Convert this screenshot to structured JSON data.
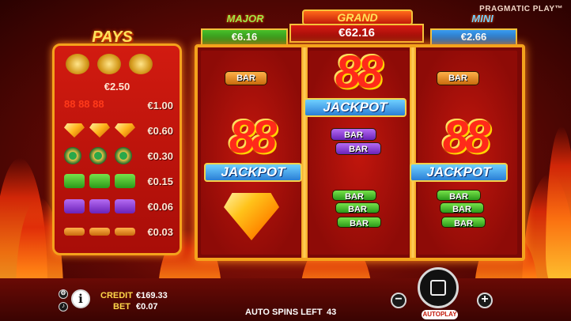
{
  "brand": "PRAGMATIC PLAY™",
  "jackpots": {
    "major": {
      "label": "MAJOR",
      "value": "€6.16"
    },
    "grand": {
      "label": "GRAND",
      "value": "€62.16"
    },
    "mini": {
      "label": "MINI",
      "value": "€2.66"
    }
  },
  "paytable": {
    "title": "PAYS",
    "top_prize": "€2.50",
    "rows": [
      {
        "symbol": "triple-88",
        "value": "€1.00"
      },
      {
        "symbol": "diamond",
        "value": "€0.60"
      },
      {
        "symbol": "coin",
        "value": "€0.30"
      },
      {
        "symbol": "green-bar",
        "value": "€0.15"
      },
      {
        "symbol": "purple-bar",
        "value": "€0.06"
      },
      {
        "symbol": "orange-bar",
        "value": "€0.03"
      }
    ]
  },
  "reels": {
    "bar_text": "BAR",
    "eights_text": "88",
    "jackpot_text": "JACKPOT"
  },
  "status": {
    "credit_label": "CREDIT",
    "credit_value": "€169.33",
    "bet_label": "BET",
    "bet_value": "€0.07",
    "auto_spins_label": "AUTO SPINS LEFT",
    "auto_spins_value": "43",
    "autoplay_label": "AUTOPLAY"
  },
  "icons": [
    "settings-icon",
    "sound-icon",
    "info-icon",
    "minus-icon",
    "plus-icon",
    "spin-stop-icon"
  ]
}
